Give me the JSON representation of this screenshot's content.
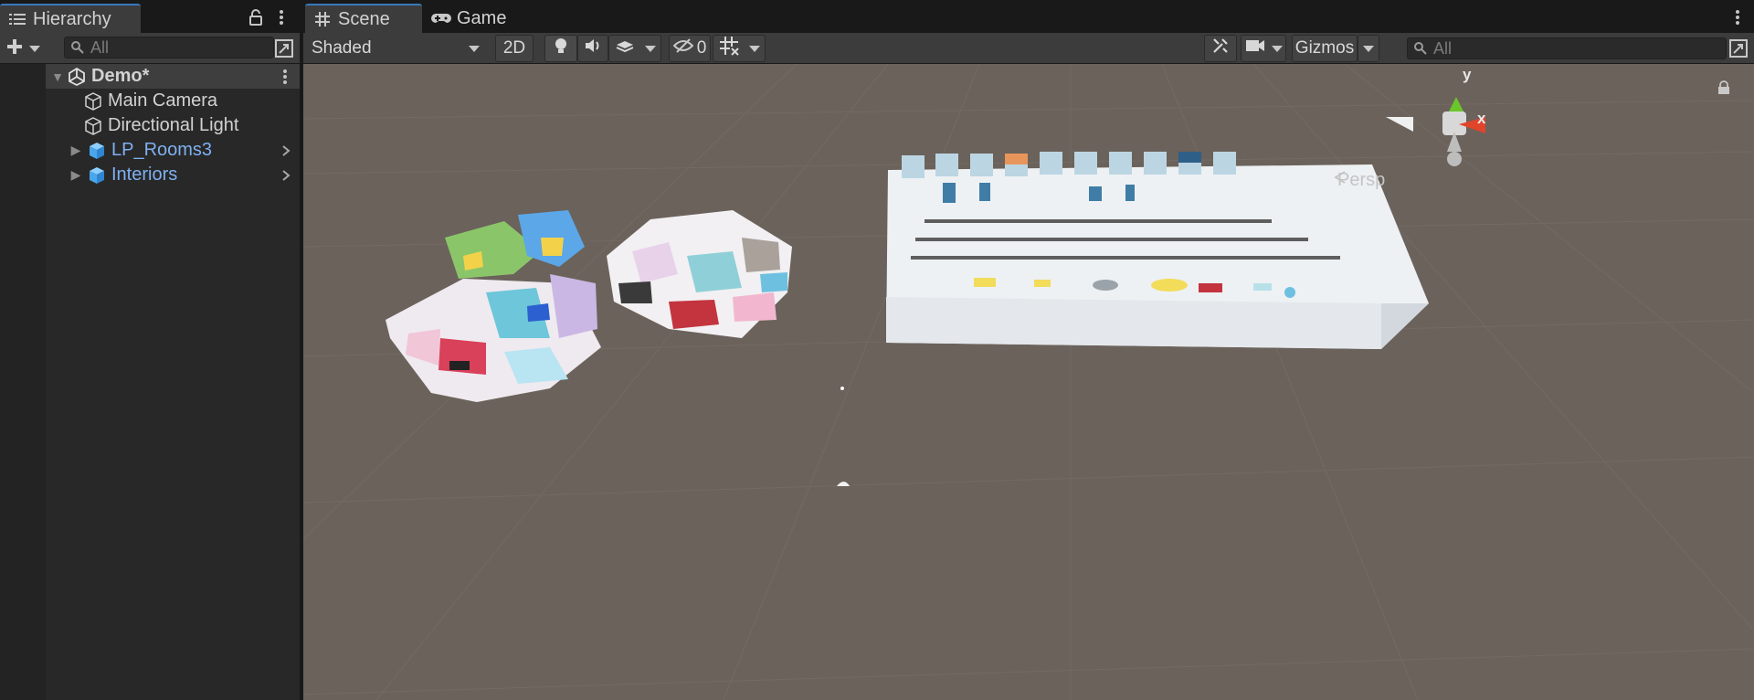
{
  "hierarchy": {
    "tab_label": "Hierarchy",
    "search_placeholder": "All",
    "items": [
      {
        "label": "Demo*",
        "kind": "scene",
        "expanded": true
      },
      {
        "label": "Main Camera",
        "kind": "gameobject"
      },
      {
        "label": "Directional Light",
        "kind": "gameobject"
      },
      {
        "label": "LP_Rooms3",
        "kind": "prefab",
        "expanded": false
      },
      {
        "label": "Interiors",
        "kind": "prefab",
        "expanded": false
      }
    ]
  },
  "scene_view": {
    "tabs": [
      {
        "label": "Scene",
        "icon": "grid-icon",
        "active": true
      },
      {
        "label": "Game",
        "icon": "gamepad-icon",
        "active": false
      }
    ],
    "shading_mode": "Shaded",
    "mode_2d_label": "2D",
    "hidden_count": "0",
    "gizmos_label": "Gizmos",
    "search_placeholder": "All",
    "projection_label": "Persp",
    "axis_labels": {
      "x": "x",
      "y": "y"
    }
  },
  "colors": {
    "accent": "#3a79bb",
    "prefab_text": "#7fb0f0",
    "viewport_bg": "#6b625b",
    "panel_bg": "#282828",
    "toolbar_bg": "#3c3c3c",
    "axis_x": "#e0452c",
    "axis_y": "#8ed13a"
  }
}
